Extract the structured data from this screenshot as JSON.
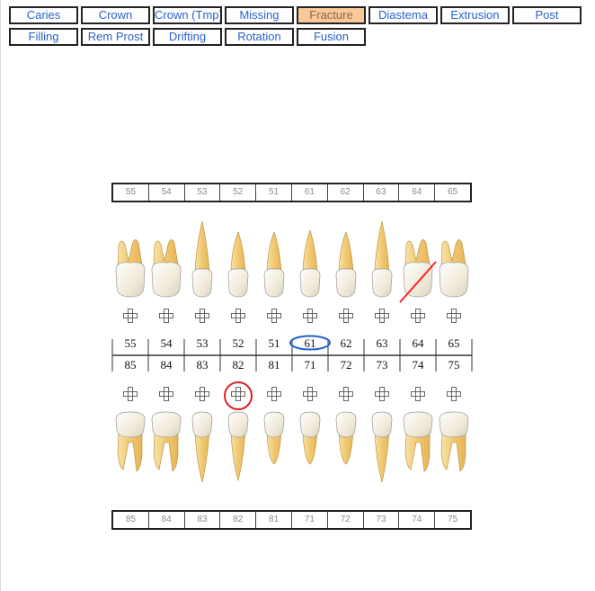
{
  "toolbar": {
    "row1": [
      {
        "id": "caries",
        "label": "Caries",
        "active": false
      },
      {
        "id": "crown",
        "label": "Crown",
        "active": false
      },
      {
        "id": "crown-tmp",
        "label": "Crown (Tmp)",
        "active": false
      },
      {
        "id": "missing",
        "label": "Missing",
        "active": false
      },
      {
        "id": "fracture",
        "label": "Fracture",
        "active": true
      },
      {
        "id": "diastema",
        "label": "Diastema",
        "active": false
      },
      {
        "id": "extrusion",
        "label": "Extrusion",
        "active": false
      },
      {
        "id": "post",
        "label": "Post",
        "active": false
      }
    ],
    "row2": [
      {
        "id": "filling",
        "label": "Filling",
        "active": false
      },
      {
        "id": "rem-prost",
        "label": "Rem Prost",
        "active": false
      },
      {
        "id": "drifting",
        "label": "Drifting",
        "active": false
      },
      {
        "id": "rotation",
        "label": "Rotation",
        "active": false
      },
      {
        "id": "fusion",
        "label": "Fusion",
        "active": false
      }
    ]
  },
  "chart": {
    "upper_teeth": [
      "55",
      "54",
      "53",
      "52",
      "51",
      "61",
      "62",
      "63",
      "64",
      "65"
    ],
    "lower_teeth": [
      "85",
      "84",
      "83",
      "82",
      "81",
      "71",
      "72",
      "73",
      "74",
      "75"
    ],
    "selected_tooth": "61",
    "fractured_tooth": "64",
    "circled_surface_tooth": "82",
    "colors": {
      "tooth_crown": "#f1ead8",
      "tooth_root": "#f0c870",
      "selection": "#1f5fd1",
      "fracture": "#ff2020",
      "surface_mark": "#e02020"
    }
  }
}
